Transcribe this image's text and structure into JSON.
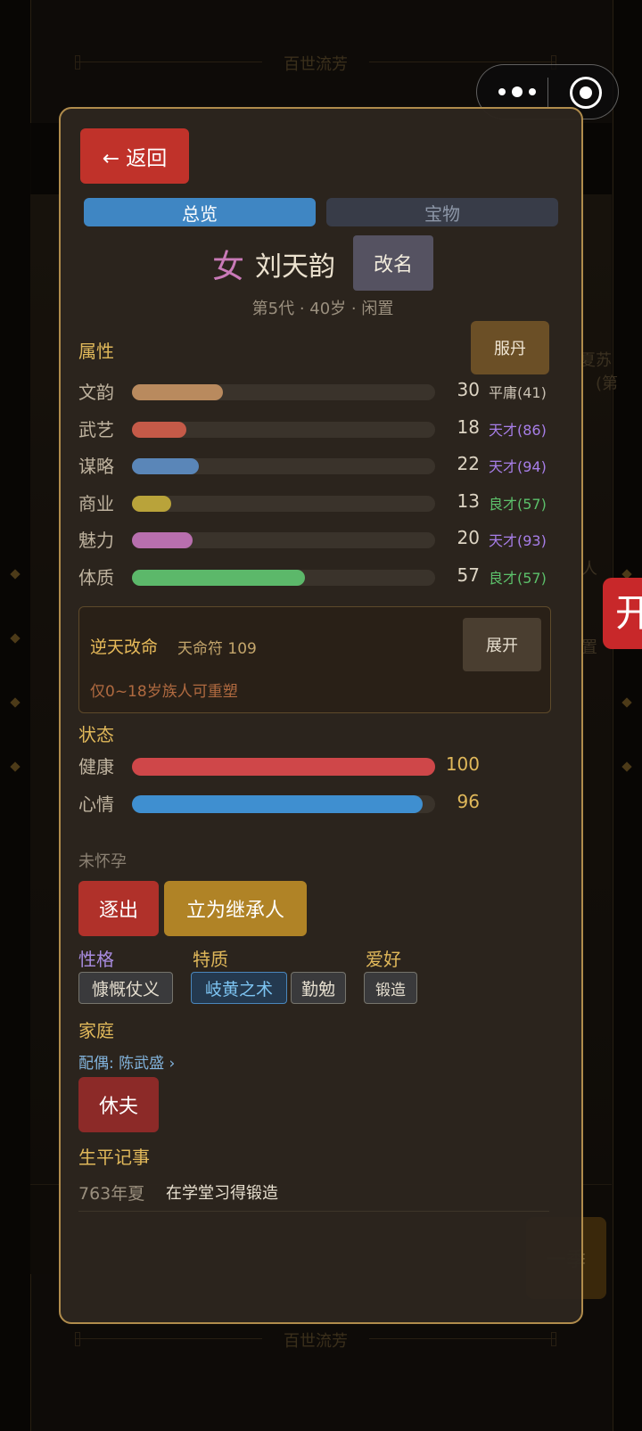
{
  "background": {
    "banner_title": "百世流芳",
    "side_text": [
      "夏苏",
      "(第",
      "人",
      "置"
    ],
    "season_button": "一季",
    "red_tab_char": "开"
  },
  "modal": {
    "back_label": "← 返回",
    "tabs": [
      {
        "label": "总览",
        "active": true
      },
      {
        "label": "宝物",
        "active": false
      }
    ],
    "character": {
      "gender_glyph": "女",
      "name": "刘天韵",
      "rename_label": "改名",
      "subtitle": "第5代 · 40岁 · 闲置"
    },
    "attributes": {
      "title": "属性",
      "pill_label": "服丹",
      "max": 100,
      "items": [
        {
          "label": "文韵",
          "value": 30,
          "grade": "平庸(41)",
          "color": "#b98a5e",
          "grade_color": "#c9c0b2"
        },
        {
          "label": "武艺",
          "value": 18,
          "grade": "天才(86)",
          "color": "#c55a48",
          "grade_color": "#a77ee8"
        },
        {
          "label": "谋略",
          "value": 22,
          "grade": "天才(94)",
          "color": "#5a86b8",
          "grade_color": "#a77ee8"
        },
        {
          "label": "商业",
          "value": 13,
          "grade": "良才(57)",
          "color": "#b9a33a",
          "grade_color": "#5cc06a"
        },
        {
          "label": "魅力",
          "value": 20,
          "grade": "天才(93)",
          "color": "#b86fae",
          "grade_color": "#a77ee8"
        },
        {
          "label": "体质",
          "value": 57,
          "grade": "良才(57)",
          "color": "#5cb86a",
          "grade_color": "#5cc06a"
        }
      ]
    },
    "fate": {
      "title": "逆天改命",
      "count_text": "天命符 109",
      "expand_label": "展开",
      "note": "仅0~18岁族人可重塑"
    },
    "status": {
      "title": "状态",
      "items": [
        {
          "label": "健康",
          "value": 100,
          "color": "#cf4749"
        },
        {
          "label": "心情",
          "value": 96,
          "color": "#3f8fd0"
        }
      ],
      "pregnancy": "未怀孕"
    },
    "actions": {
      "expel_label": "逐出",
      "heir_label": "立为继承人"
    },
    "traits": {
      "personality_title": "性格",
      "personality_tags": [
        "慷慨仗义"
      ],
      "quality_title": "特质",
      "quality_tags": [
        "岐黄之术",
        "勤勉"
      ],
      "hobby_title": "爱好",
      "hobby_tags": [
        "锻造"
      ]
    },
    "family": {
      "title": "家庭",
      "spouse_text": "配偶: 陈武盛 ›",
      "divorce_label": "休夫"
    },
    "life": {
      "title": "生平记事",
      "events": [
        {
          "when": "763年夏",
          "what": "在学堂习得锻造"
        }
      ]
    }
  }
}
